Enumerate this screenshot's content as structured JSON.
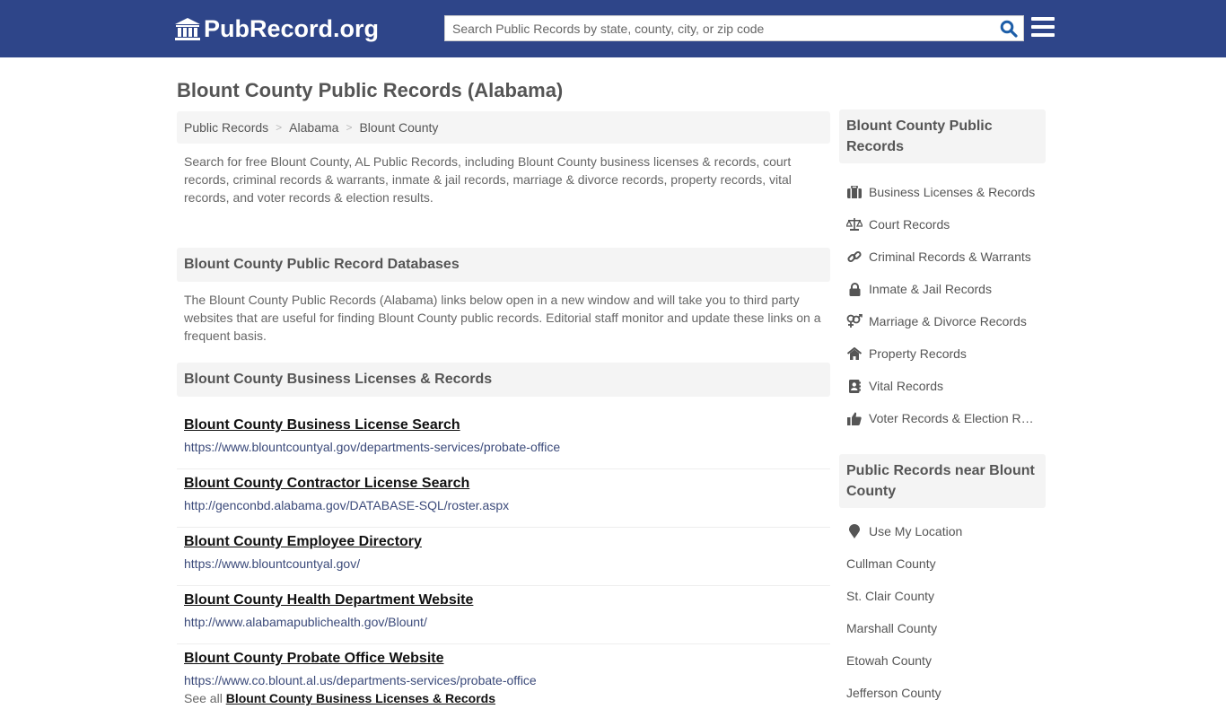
{
  "header": {
    "logo_text": "PubRecord.org",
    "search_placeholder": "Search Public Records by state, county, city, or zip code",
    "search_value": ""
  },
  "page": {
    "title": "Blount County Public Records (Alabama)",
    "breadcrumb": [
      "Public Records",
      "Alabama",
      "Blount County"
    ],
    "breadcrumb_separator": ">",
    "intro": "Search for free Blount County, AL Public Records, including Blount County business licenses & records, court records, criminal records & warrants, inmate & jail records, marriage & divorce records, property records, vital records, and voter records & election results.",
    "databases_heading": "Blount County Public Record Databases",
    "databases_text": "The Blount County Public Records (Alabama) links below open in a new window and will take you to third party websites that are useful for finding Blount County public records. Editorial staff monitor and update these links on a frequent basis.",
    "business_heading": "Blount County Business Licenses & Records",
    "business_links": [
      {
        "title": "Blount County Business License Search",
        "url": "https://www.blountcountyal.gov/departments-services/probate-office"
      },
      {
        "title": "Blount County Contractor License Search",
        "url": "http://genconbd.alabama.gov/DATABASE-SQL/roster.aspx"
      },
      {
        "title": "Blount County Employee Directory",
        "url": "https://www.blountcountyal.gov/"
      },
      {
        "title": "Blount County Health Department Website",
        "url": "http://www.alabamapublichealth.gov/Blount/"
      },
      {
        "title": "Blount County Probate Office Website",
        "url": "https://www.co.blount.al.us/departments-services/probate-office"
      }
    ],
    "see_all_prefix": "See all",
    "see_all_link": "Blount County Business Licenses & Records"
  },
  "sidebar": {
    "records_heading": "Blount County Public Records",
    "record_items": [
      {
        "icon": "briefcase-icon",
        "label": "Business Licenses & Records"
      },
      {
        "icon": "scale-icon",
        "label": "Court Records"
      },
      {
        "icon": "link-icon",
        "label": "Criminal Records & Warrants"
      },
      {
        "icon": "lock-icon",
        "label": "Inmate & Jail Records"
      },
      {
        "icon": "gender-icon",
        "label": "Marriage & Divorce Records"
      },
      {
        "icon": "home-icon",
        "label": "Property Records"
      },
      {
        "icon": "contact-book-icon",
        "label": "Vital Records"
      },
      {
        "icon": "thumbs-up-icon",
        "label": "Voter Records & Election Results"
      }
    ],
    "near_heading": "Public Records near Blount County",
    "use_location": "Use My Location",
    "near_items": [
      "Cullman County",
      "St. Clair County",
      "Marshall County",
      "Etowah County",
      "Jefferson County"
    ]
  },
  "colors": {
    "header_bg": "#2e4589",
    "search_icon": "#1d5ea8",
    "link_url": "#3b4a7a",
    "section_bg": "#f4f4f4"
  }
}
